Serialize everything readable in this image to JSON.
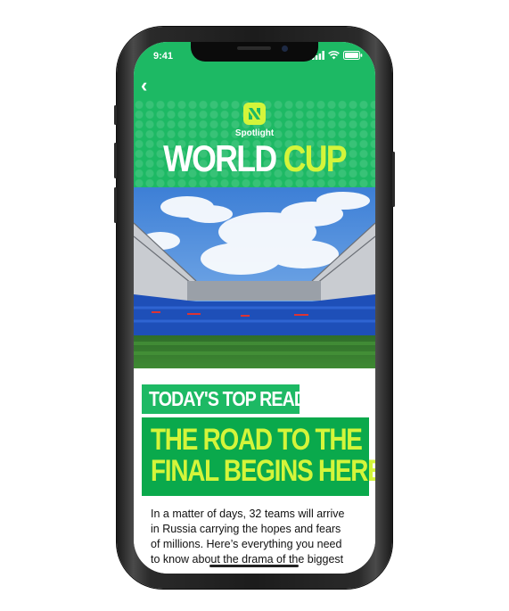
{
  "status_bar": {
    "time": "9:41"
  },
  "header": {
    "back_glyph": "‹",
    "brand_label": "Spotlight",
    "title_part1": "WORLD",
    "title_part2": "CUP",
    "accent_color": "#d4f53a",
    "header_color": "#1db964"
  },
  "hero": {
    "alt": "Football stadium under blue sky"
  },
  "article": {
    "kicker": "TODAY'S TOP READ",
    "headline_lines": [
      "THE ROAD TO THE",
      "FINAL BEGINS HERE"
    ],
    "body_lines": [
      "In a matter of days, 32 teams will arrive",
      "in Russia carrying the hopes and fears",
      "of millions. Here’s everything you need",
      "to know about the drama of the biggest"
    ]
  }
}
